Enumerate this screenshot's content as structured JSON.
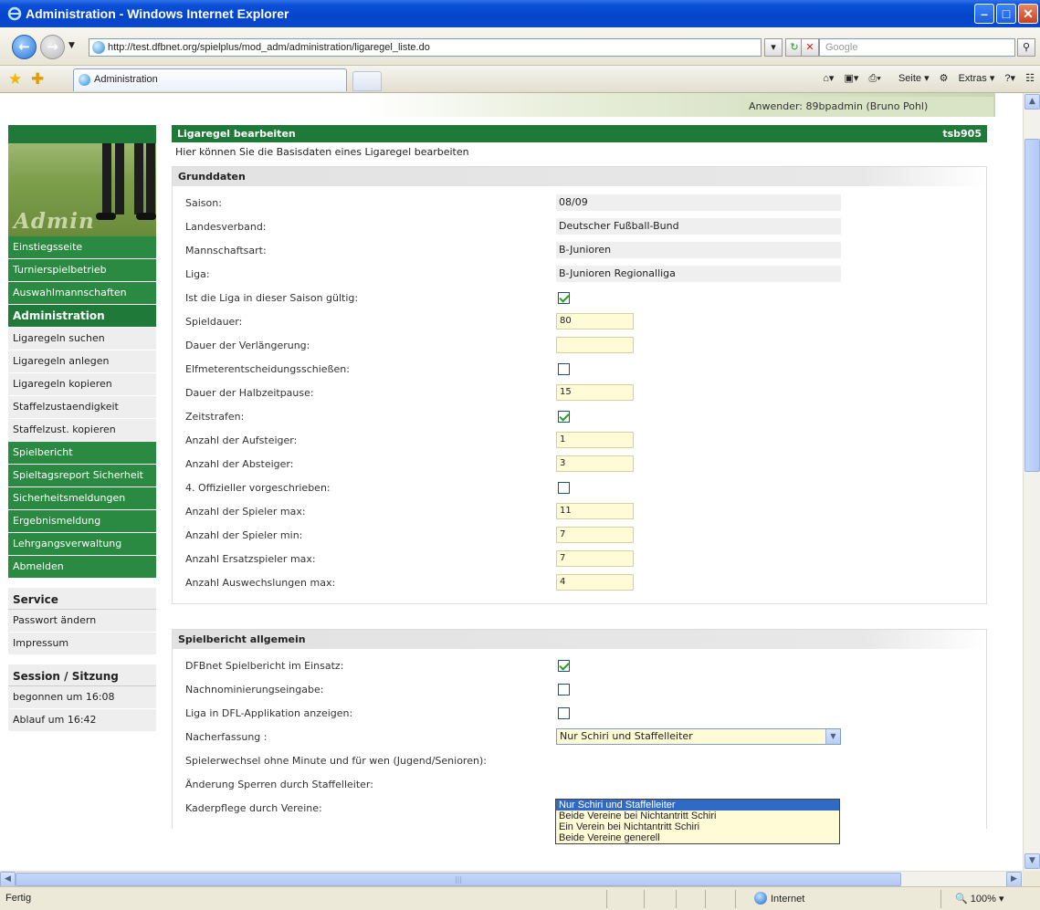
{
  "window": {
    "title": "Administration - Windows Internet Explorer",
    "address": "http://test.dfbnet.org/spielplus/mod_adm/administration/ligaregel_liste.do",
    "search_placeholder": "Google",
    "tab_label": "Administration",
    "cmd_seite": "Seite",
    "cmd_extras": "Extras",
    "status_text": "Fertig",
    "zone": "Internet",
    "zoom": "100%"
  },
  "header": {
    "user": "Anwender: 89bpadmin (Bruno Pohl)"
  },
  "sidebar": {
    "logo_text": "Admin",
    "nav": [
      {
        "label": "Einstiegsseite"
      },
      {
        "label": "Turnierspielbetrieb"
      },
      {
        "label": "Auswahlmannschaften"
      }
    ],
    "admin_header": "Administration",
    "admin_items": [
      {
        "label": "Ligaregeln suchen"
      },
      {
        "label": "Ligaregeln anlegen"
      },
      {
        "label": "Ligaregeln kopieren"
      },
      {
        "label": "Staffelzustaendigkeit"
      },
      {
        "label": "Staffelzust. kopieren"
      }
    ],
    "nav2": [
      {
        "label": "Spielbericht"
      },
      {
        "label": "Spieltagsreport Sicherheit"
      },
      {
        "label": "Sicherheitsmeldungen"
      },
      {
        "label": "Ergebnismeldung"
      },
      {
        "label": "Lehrgangsverwaltung"
      },
      {
        "label": "Abmelden"
      }
    ],
    "service_header": "Service",
    "service_items": [
      {
        "label": "Passwort ändern"
      },
      {
        "label": "Impressum"
      }
    ],
    "session_header": "Session / Sitzung",
    "session_items": [
      {
        "label": "begonnen um 16:08"
      },
      {
        "label": "Ablauf um 16:42"
      }
    ]
  },
  "main": {
    "title": "Ligaregel bearbeiten",
    "code": "tsb905",
    "intro": "Hier können Sie die Basisdaten eines Ligaregel bearbeiten",
    "grunddaten_title": "Grunddaten",
    "ro_fields": [
      {
        "label": "Saison:",
        "value": "08/09"
      },
      {
        "label": "Landesverband:",
        "value": "Deutscher Fußball-Bund"
      },
      {
        "label": "Mannschaftsart:",
        "value": "B-Junioren"
      },
      {
        "label": "Liga:",
        "value": "B-Junioren Regionalliga"
      }
    ],
    "gueltig_label": "Ist die Liga in dieser Saison gültig:",
    "spieldauer_label": "Spieldauer:",
    "spieldauer_value": "80",
    "verlaengerung_label": "Dauer der Verlängerung:",
    "verlaengerung_value": "",
    "elfmeter_label": "Elfmeterentscheidungsschießen:",
    "halbzeit_label": "Dauer der Halbzeitpause:",
    "halbzeit_value": "15",
    "zeitstrafen_label": "Zeitstrafen:",
    "aufsteiger_label": "Anzahl der Aufsteiger:",
    "aufsteiger_value": "1",
    "absteiger_label": "Anzahl der Absteiger:",
    "absteiger_value": "3",
    "offizieller_label": "4. Offizieller vorgeschrieben:",
    "spieler_max_label": "Anzahl der Spieler max:",
    "spieler_max_value": "11",
    "spieler_min_label": "Anzahl der Spieler min:",
    "spieler_min_value": "7",
    "ersatz_label": "Anzahl Ersatzspieler max:",
    "ersatz_value": "7",
    "auswechslungen_label": "Anzahl Auswechslungen max:",
    "auswechslungen_value": "4",
    "spielbericht_title": "Spielbericht allgemein",
    "dfbnet_label": "DFBnet Spielbericht im Einsatz:",
    "nachnominierung_label": "Nachnominierungseingabe:",
    "dfl_label": "Liga in DFL-Applikation anzeigen:",
    "nacherfassung_label": "Nacherfassung :",
    "nacherfassung_value": "Nur Schiri und Staffelleiter",
    "spielerwechsel_label": "Spielerwechsel ohne Minute und für wen (Jugend/Senioren):",
    "sperren_label": "Änderung Sperren durch Staffelleiter:",
    "kaderpflege_label": "Kaderpflege durch Vereine:",
    "dropdown_options": [
      "Nur Schiri und Staffelleiter",
      "Beide Vereine bei Nichtantritt Schiri",
      "Ein Verein bei Nichtantritt Schiri",
      "Beide Vereine generell"
    ]
  }
}
